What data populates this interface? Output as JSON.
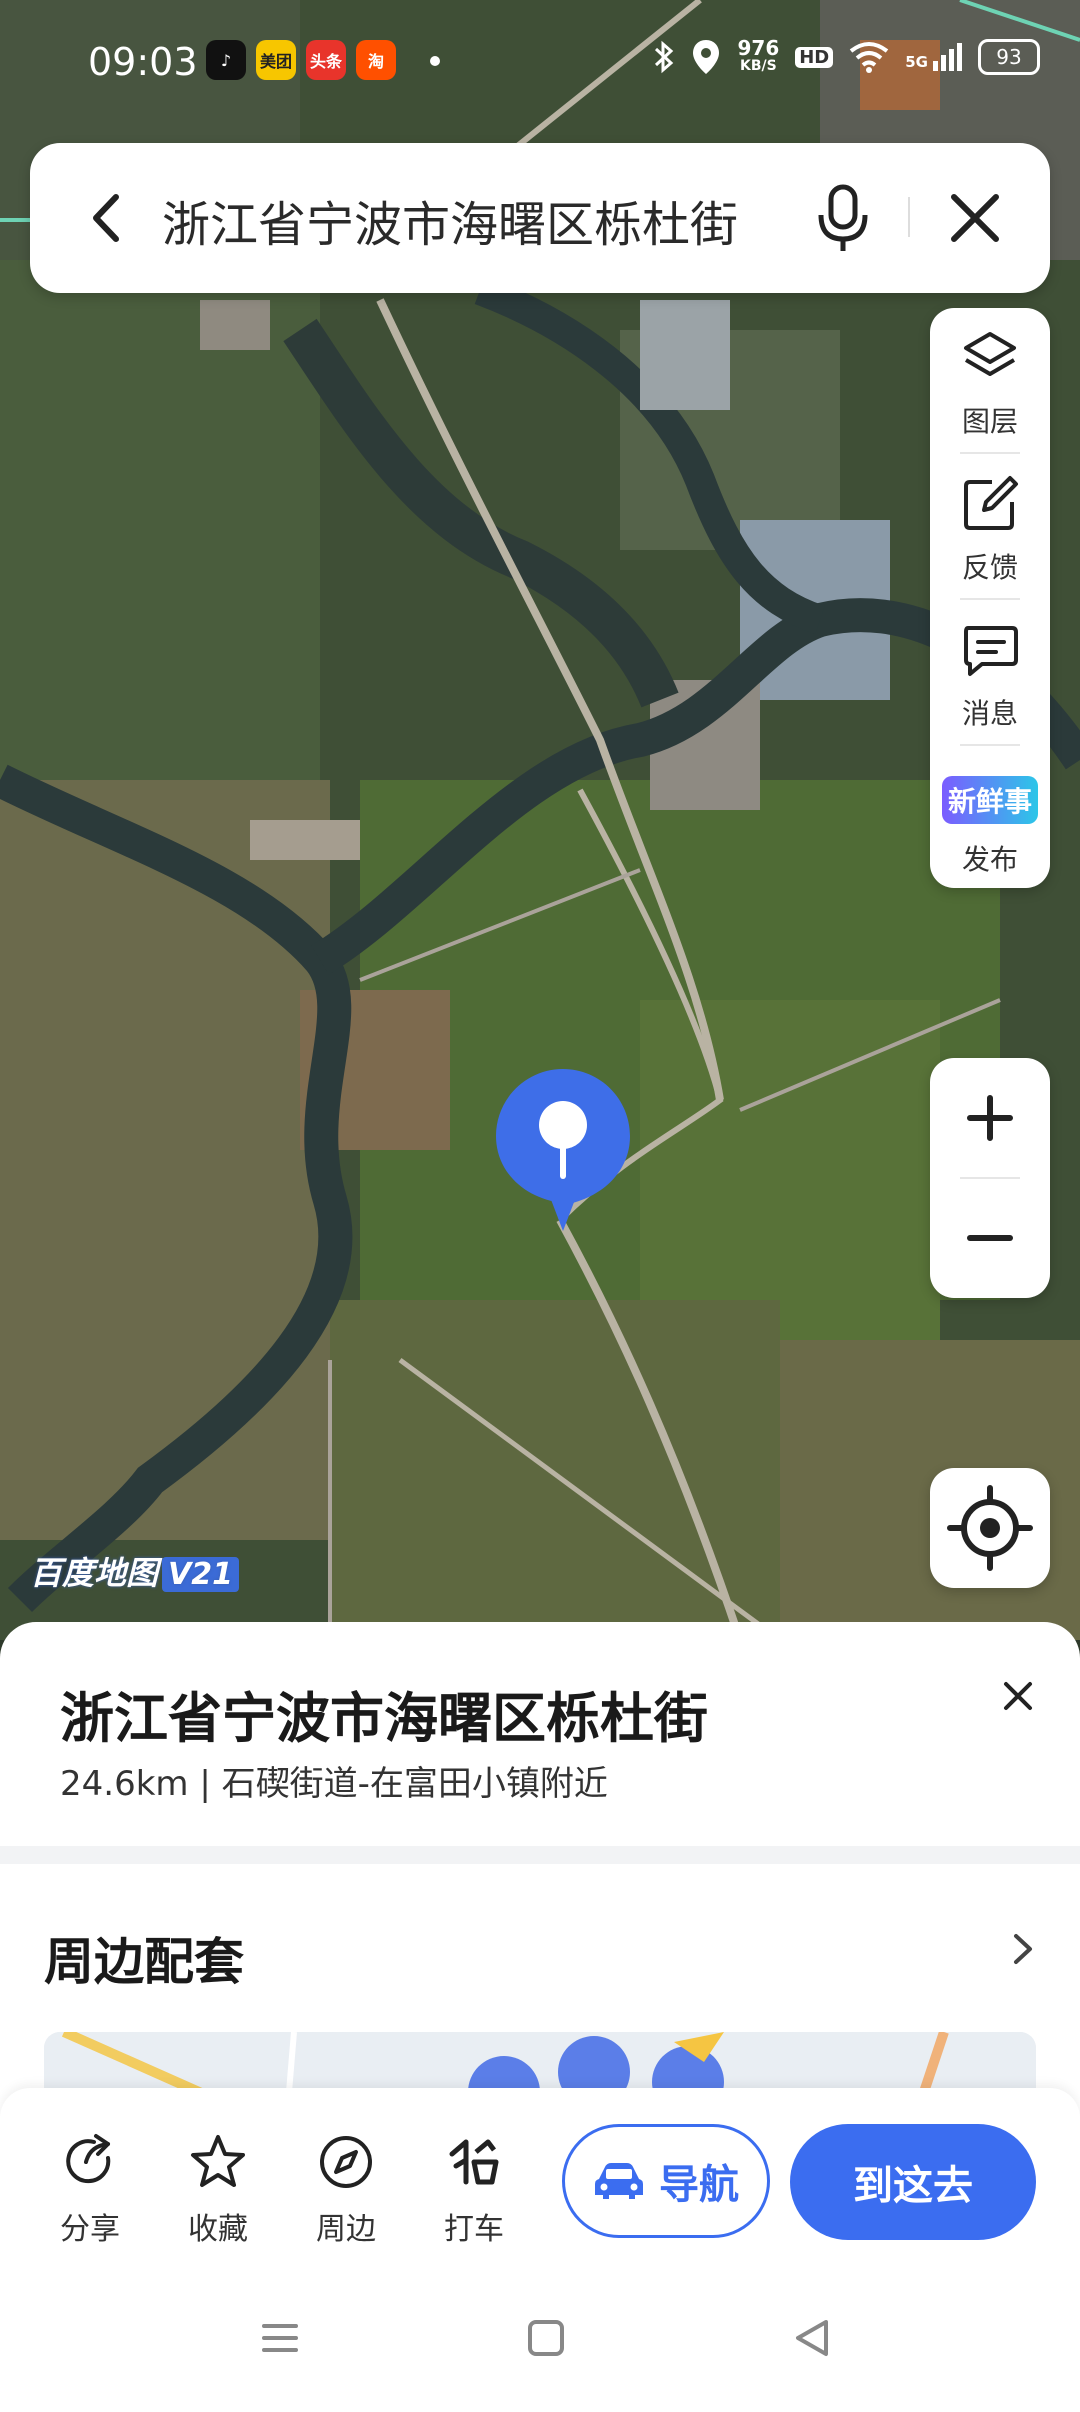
{
  "status_bar": {
    "time": "09:03",
    "apps": [
      {
        "name": "douyin-icon",
        "label": "♪",
        "color": "#111111"
      },
      {
        "name": "meituan-icon",
        "label": "美团",
        "color": "#f7c600"
      },
      {
        "name": "toutiao-icon",
        "label": "头条",
        "color": "#e8342b"
      },
      {
        "name": "taobao-icon",
        "label": "淘",
        "color": "#ff5000"
      }
    ],
    "speed": "976",
    "speed_unit": "KB/S",
    "hd": "HD",
    "network": "5G",
    "battery": "93"
  },
  "search": {
    "query": "浙江省宁波市海曙区栎杜街"
  },
  "tools": {
    "layers": "图层",
    "feedback": "反馈",
    "messages": "消息",
    "publish_badge": "新鲜事",
    "publish": "发布"
  },
  "zoom": {
    "in": "+",
    "out": "−"
  },
  "watermark": {
    "brand": "百度地图",
    "version": "V21"
  },
  "place": {
    "title": "浙江省宁波市海曙区栎杜街",
    "subtitle": "24.6km | 石碶街道-在富田小镇附近"
  },
  "nearby": {
    "title": "周边配套"
  },
  "actions": {
    "share": "分享",
    "favorite": "收藏",
    "nearby": "周边",
    "taxi": "打车",
    "navigate": "导航",
    "go_here": "到这去"
  },
  "colors": {
    "accent": "#3b6df0",
    "pin": "#3e6ee8"
  }
}
